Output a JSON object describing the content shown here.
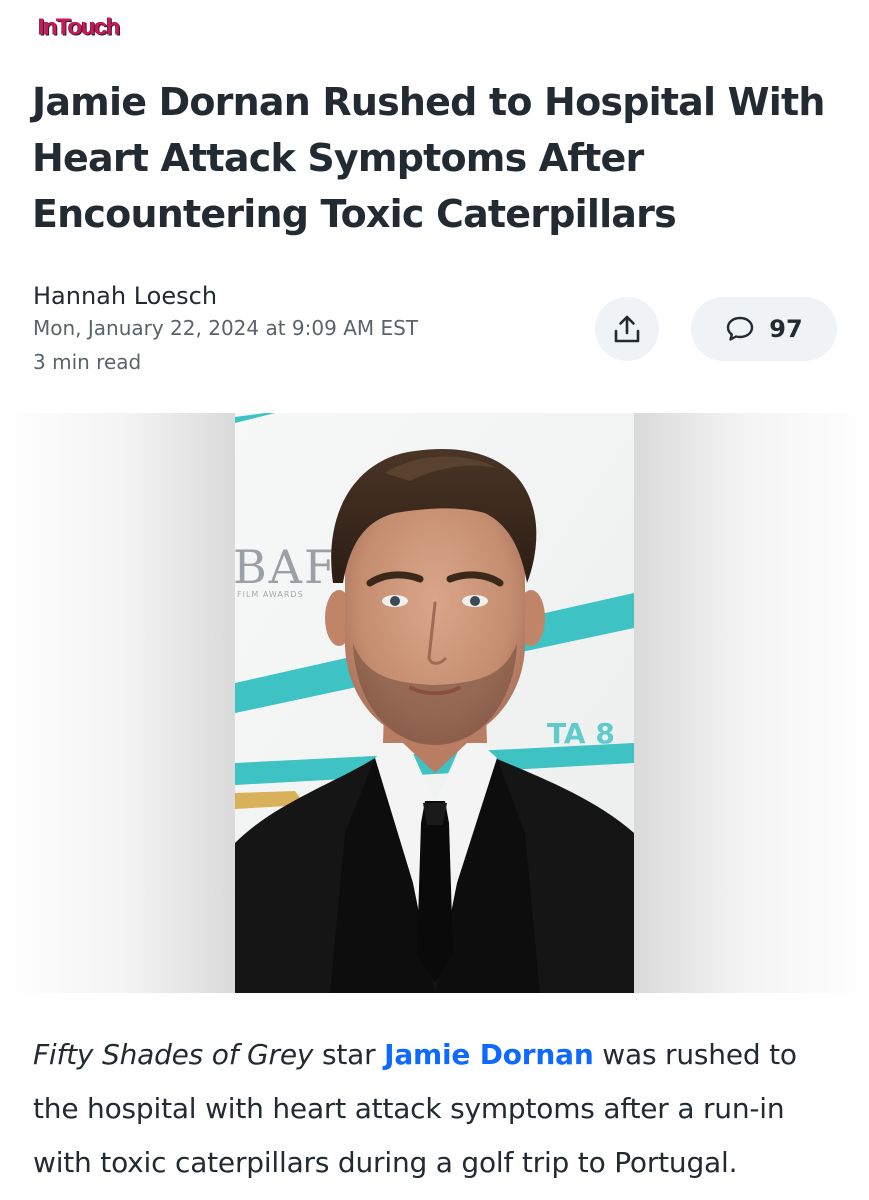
{
  "publisher": {
    "logo_text": "InTouch"
  },
  "article": {
    "headline": "Jamie Dornan Rushed to Hospital With Heart Attack Symptoms After Encountering Toxic Caterpillars",
    "author": "Hannah Loesch",
    "date": "Mon, January 22, 2024 at 9:09 AM EST",
    "read_time": "3 min read",
    "comment_count": "97",
    "body": {
      "italic_title": "Fifty Shades of Grey",
      "text_1": " star ",
      "link_text": "Jamie Dornan",
      "text_2": " was rushed to the hospital with heart attack symptoms after a run-in with toxic caterpillars during a golf trip to Portugal."
    }
  },
  "hero_image": {
    "backdrop_text": "BAFT",
    "backdrop_subtext": "FILM AWARDS",
    "backdrop_badge": "TA 8"
  },
  "icons": {
    "share": "share-icon",
    "comment": "comment-icon"
  },
  "colors": {
    "brand": "#d4145a",
    "link": "#0f69ff",
    "button_bg": "#f0f3f5",
    "backdrop_accent": "#3ec2c4"
  }
}
